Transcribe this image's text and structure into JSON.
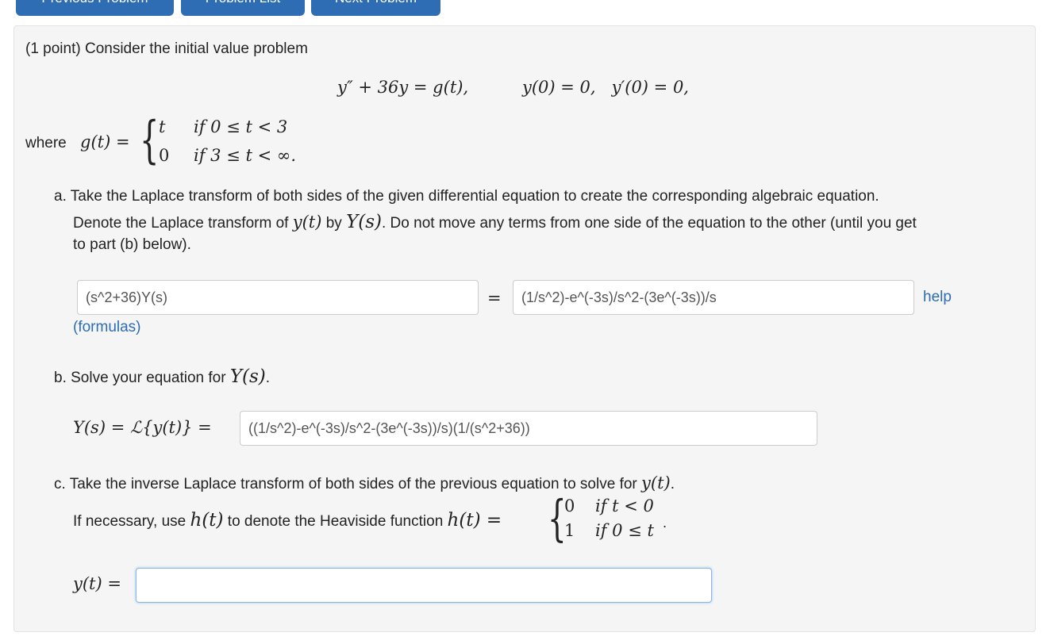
{
  "nav": {
    "previous": "Previous Problem",
    "list": "Problem List",
    "next": "Next Problem"
  },
  "problem": {
    "intro": "(1 point) Consider the initial value problem",
    "ode": "y″ + 36y = g(t),",
    "initial_conditions": "y(0) = 0,   y′(0) = 0,",
    "where_label": "where",
    "g_def": "g(t) =",
    "g_case1_value": "t",
    "g_case1_cond": "if 0 ≤ t < 3",
    "g_case2_value": "0",
    "g_case2_cond": "if 3 ≤ t < ∞."
  },
  "part_a": {
    "line1": "a. Take the Laplace transform of both sides of the given differential equation to create the corresponding algebraic equation.",
    "line2_pre": "Denote the Laplace transform of",
    "line2_y": "y(t)",
    "line2_by": "by",
    "line2_Y": "Y(s)",
    "line2_post": ". Do not move any terms from one side of the equation to the other (until you get",
    "line3": "to part (b) below).",
    "lhs_value": "(s^2+36)Y(s)",
    "equals": "=",
    "rhs_value": "(1/s^2)-e^(-3s)/s^2-(3e^(-3s))/s",
    "help_link": "help",
    "formulas_link": "(formulas)"
  },
  "part_b": {
    "prompt_pre": "b. Solve your equation for",
    "prompt_Y": "Y(s)",
    "prompt_post": ".",
    "lhs": "Y(s) = ℒ{y(t)} =",
    "answer_value": "((1/s^2)-e^(-3s)/s^2-(3e^(-3s))/s)(1/(s^2+36))"
  },
  "part_c": {
    "prompt_pre": "c. Take the inverse Laplace transform of both sides of the previous equation to solve for",
    "prompt_y": "y(t)",
    "prompt_post": ".",
    "heaviside_pre": "If necessary, use",
    "heaviside_h": "h(t)",
    "heaviside_mid": "to denote the Heaviside function",
    "heaviside_def": "h(t) =",
    "h_case1_value": "0",
    "h_case1_cond": "if t < 0",
    "h_case2_value": "1",
    "h_case2_cond": "if 0 ≤ t",
    "h_tail": ".",
    "lhs": "y(t) =",
    "answer_value": ""
  }
}
